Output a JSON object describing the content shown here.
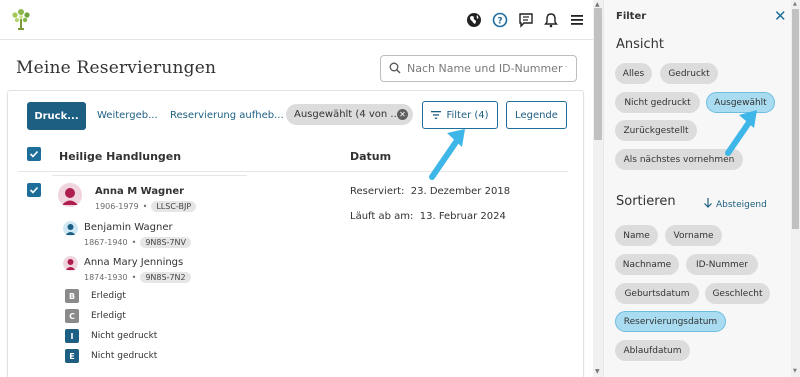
{
  "header": {
    "icons": [
      "globe-icon",
      "help-icon",
      "chat-icon",
      "bell-icon",
      "menu-icon"
    ]
  },
  "main": {
    "title": "Meine Reservierungen",
    "search_placeholder": "Nach Name und ID-Nummer fil"
  },
  "toolbar": {
    "print_label": "Druck...",
    "forward_label": "Weitergeb...",
    "cancel_label": "Reservierung aufheb...",
    "selected_chip": "Ausgewählt (4 von ...",
    "filter_label": "Filter (4)",
    "legend_label": "Legende"
  },
  "table": {
    "col_ordinances": "Heilige Handlungen",
    "col_date": "Datum"
  },
  "row": {
    "primary": {
      "name": "Anna M Wagner",
      "lifespan": "1906-1979",
      "id": "LLSC-BJP"
    },
    "father": {
      "name": "Benjamin Wagner",
      "lifespan": "1867-1940",
      "id": "9N8S-7NV"
    },
    "mother": {
      "name": "Anna Mary Jennings",
      "lifespan": "1874-1930",
      "id": "9N8S-7N2"
    },
    "ordinances": [
      {
        "letter": "B",
        "status": "Erledigt",
        "color": "#8a8a8a"
      },
      {
        "letter": "C",
        "status": "Erledigt",
        "color": "#8a8a8a"
      },
      {
        "letter": "I",
        "status": "Nicht gedruckt",
        "color": "#1d5f82"
      },
      {
        "letter": "E",
        "status": "Nicht gedruckt",
        "color": "#1d5f82"
      }
    ],
    "reserved_label": "Reserviert:",
    "reserved_date": "23. Dezember 2018",
    "expires_label": "Läuft ab am:",
    "expires_date": "13. Februar 2024"
  },
  "filter_panel": {
    "title": "Filter",
    "view_title": "Ansicht",
    "view_options": [
      "Alles",
      "Gedruckt",
      "Nicht gedruckt",
      "Ausgewählt",
      "Zurückgestellt",
      "Als nächstes vornehmen"
    ],
    "view_active": "Ausgewählt",
    "sort_title": "Sortieren",
    "sort_direction": "Absteigend",
    "sort_options": [
      "Name",
      "Vorname",
      "Nachname",
      "ID-Nummer",
      "Geburtsdatum",
      "Geschlecht",
      "Reservierungsdatum",
      "Ablaufdatum"
    ],
    "sort_active": "Reservierungsdatum"
  },
  "colors": {
    "primary": "#1d5f82",
    "accent": "#1d6f9a",
    "active_chip": "#a9dcf0",
    "arrow": "#3fb6e8"
  }
}
